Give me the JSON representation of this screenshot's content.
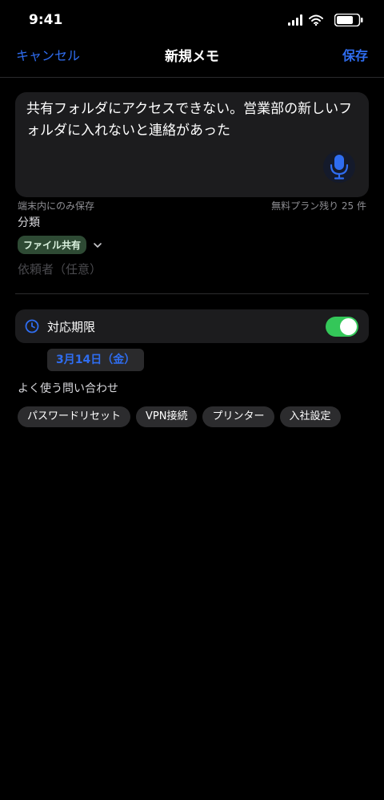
{
  "status_bar": {
    "time": "9:41",
    "icons": [
      "signal-icon",
      "wifi-icon",
      "battery-icon"
    ]
  },
  "nav": {
    "cancel_label": "キャンセル",
    "title": "新規メモ",
    "save_label": "保存"
  },
  "memo": {
    "text": "共有フォルダにアクセスできない。営業部の新しいフォルダに入れないと連絡があった",
    "mic_icon": "microphone-icon",
    "note_left": "端末内にのみ保存",
    "note_right": "無料プラン残り 25 件"
  },
  "category": {
    "label": "分類",
    "selected": "ファイル共有"
  },
  "requester": {
    "placeholder": "依頼者（任意）",
    "value": ""
  },
  "deadline": {
    "label": "対応期限",
    "icon": "clock-icon",
    "enabled": true,
    "date": "3月14日（金）"
  },
  "faq": {
    "label": "よく使う問い合わせ",
    "chips": [
      {
        "label": "パスワードリセット"
      },
      {
        "label": "VPN接続"
      },
      {
        "label": "プリンター"
      },
      {
        "label": "入社設定"
      }
    ]
  },
  "colors": {
    "accent": "#2f6df0",
    "toggle_on": "#34c759",
    "category_chip_bg": "#2e4a34",
    "background": "#000000",
    "card": "#1c1c1e"
  }
}
